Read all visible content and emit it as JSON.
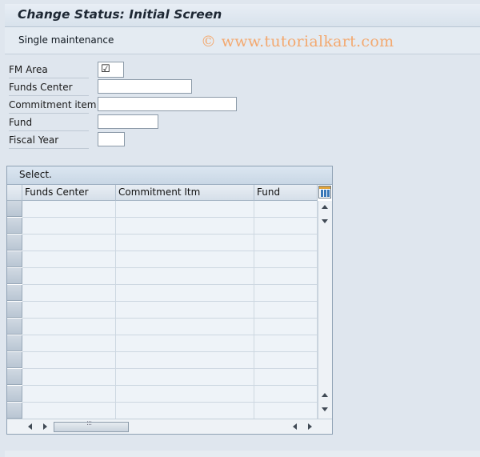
{
  "window": {
    "title": "Change Status: Initial Screen"
  },
  "toolbar": {
    "single_maintenance_label": "Single maintenance",
    "watermark": "© www.tutorialkart.com"
  },
  "form": {
    "fm_area": {
      "label": "FM Area",
      "checked": true,
      "check_glyph": "☑"
    },
    "funds_center": {
      "label": "Funds Center",
      "value": ""
    },
    "commitment_item": {
      "label": "Commitment item",
      "value": ""
    },
    "fund": {
      "label": "Fund",
      "value": ""
    },
    "fiscal_year": {
      "label": "Fiscal Year",
      "value": ""
    }
  },
  "table": {
    "title": "Select.",
    "columns": [
      "Funds Center",
      "Commitment Itm",
      "Fund"
    ],
    "rows": [
      [
        "",
        "",
        ""
      ],
      [
        "",
        "",
        ""
      ],
      [
        "",
        "",
        ""
      ],
      [
        "",
        "",
        ""
      ],
      [
        "",
        "",
        ""
      ],
      [
        "",
        "",
        ""
      ],
      [
        "",
        "",
        ""
      ],
      [
        "",
        "",
        ""
      ],
      [
        "",
        "",
        ""
      ],
      [
        "",
        "",
        ""
      ],
      [
        "",
        "",
        ""
      ],
      [
        "",
        "",
        ""
      ],
      [
        "",
        "",
        ""
      ]
    ]
  },
  "icons": {
    "table_settings": "table-settings-icon",
    "scroll_up": "scroll-up-icon",
    "scroll_down": "scroll-down-icon",
    "scroll_left": "scroll-left-icon",
    "scroll_right": "scroll-right-icon",
    "thumb_grip": ":::"
  },
  "colors": {
    "background": "#dfe6ee",
    "watermark": "#f3a970",
    "cell": "#eef3f8",
    "title_text": "#1d2733"
  }
}
